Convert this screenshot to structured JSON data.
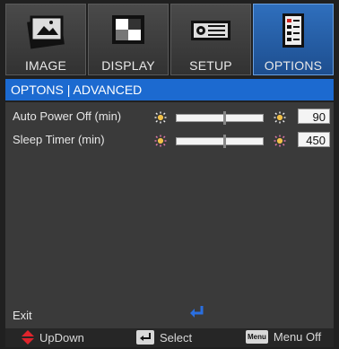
{
  "tabs": [
    {
      "label": "IMAGE",
      "icon": "image-icon",
      "active": false
    },
    {
      "label": "DISPLAY",
      "icon": "display-icon",
      "active": false
    },
    {
      "label": "SETUP",
      "icon": "setup-icon",
      "active": false
    },
    {
      "label": "OPTIONS",
      "icon": "options-icon",
      "active": true
    }
  ],
  "section_title": "OPTONS | ADVANCED",
  "settings": [
    {
      "label": "Auto Power Off (min)",
      "value": "90",
      "slider_fraction": 0.55
    },
    {
      "label": "Sleep Timer (min)",
      "value": "450",
      "slider_fraction": 0.55
    }
  ],
  "exit_label": "Exit",
  "footer": {
    "updown": "UpDown",
    "select": "Select",
    "menu_off": "Menu Off",
    "menu_key": "Menu"
  },
  "colors": {
    "accent": "#1c6ad0",
    "updown_arrow": "#e0242c",
    "enter_arrow": "#2a6fe0"
  }
}
